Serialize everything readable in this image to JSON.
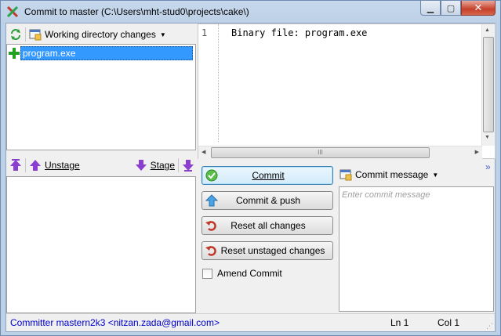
{
  "window": {
    "title": "Commit to master (C:\\Users\\mht-stud0\\projects\\cake\\)",
    "minimize_glyph": "▁",
    "maximize_glyph": "▢",
    "close_glyph": "✕"
  },
  "working_dir": {
    "dropdown_label": "Working directory changes",
    "files": [
      {
        "name": "program.exe",
        "status_icon": "plus-icon"
      }
    ]
  },
  "staging": {
    "unstage_label": "Unstage",
    "stage_label": "Stage"
  },
  "diff": {
    "line_number": "1",
    "content": "Binary file: program.exe"
  },
  "actions": {
    "commit": "Commit",
    "commit_push": "Commit & push",
    "reset_all": "Reset all changes",
    "reset_unstaged": "Reset unstaged changes",
    "amend": "Amend Commit",
    "amend_checked": false
  },
  "message": {
    "header_label": "Commit message",
    "placeholder": "Enter commit message",
    "expand_glyph": "»"
  },
  "status": {
    "committer": "Committer mastern2k3 <nitzan.zada@gmail.com>",
    "ln": "Ln 1",
    "col": "Col 1"
  },
  "colors": {
    "accent": "#3399ff",
    "status_text": "#0000cc",
    "stage_arrow": "#8a3fd1",
    "add_green": "#22a022"
  }
}
